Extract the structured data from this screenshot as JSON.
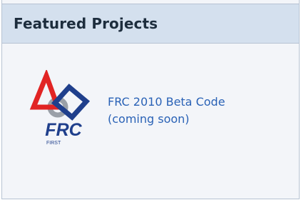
{
  "panel": {
    "title": "Featured Projects"
  },
  "projects": [
    {
      "name": "FRC 2010 Beta Code",
      "status": "(coming soon)",
      "logo": {
        "icon": "frc-logo-icon",
        "text": "FRC",
        "subtext": "FIRST"
      }
    }
  ],
  "colors": {
    "header_bg": "#d4e0ee",
    "panel_bg": "#f3f5f9",
    "border": "#b7c3d3",
    "link": "#2a62b6",
    "logo_red": "#e12424",
    "logo_blue": "#1f3f8c",
    "logo_gray": "#9aa0a8"
  }
}
